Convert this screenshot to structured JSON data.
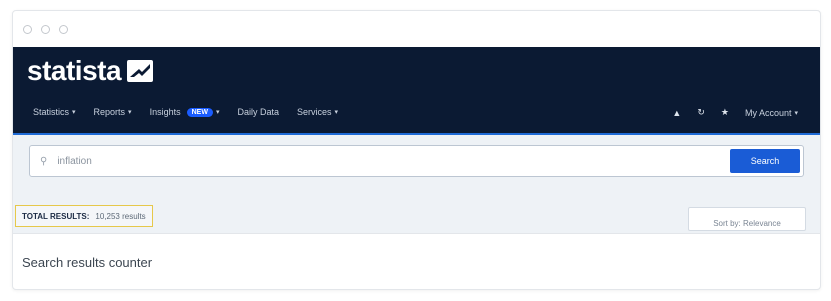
{
  "window": {
    "controls": [
      "close",
      "minimize",
      "maximize"
    ]
  },
  "header": {
    "logo_text": "statista",
    "nav": [
      {
        "label": "Statistics",
        "caret": "▾"
      },
      {
        "label": "Reports",
        "caret": "▾"
      },
      {
        "label": "Insights",
        "badge": "NEW",
        "caret": "▾"
      },
      {
        "label": "Daily Data"
      },
      {
        "label": "Services",
        "caret": "▾"
      }
    ],
    "right": {
      "account_label": "My Account",
      "caret": "▾"
    }
  },
  "search": {
    "value": "inflation",
    "button_label": "Search"
  },
  "results": {
    "label": "TOTAL RESULTS:",
    "value": "10,253 results",
    "sort_label": "Sort by: Relevance"
  },
  "caption": "Search results counter",
  "colors": {
    "header_bg": "#0b1a33",
    "accent": "#1a5cd6",
    "highlight": "#e6c84a"
  }
}
